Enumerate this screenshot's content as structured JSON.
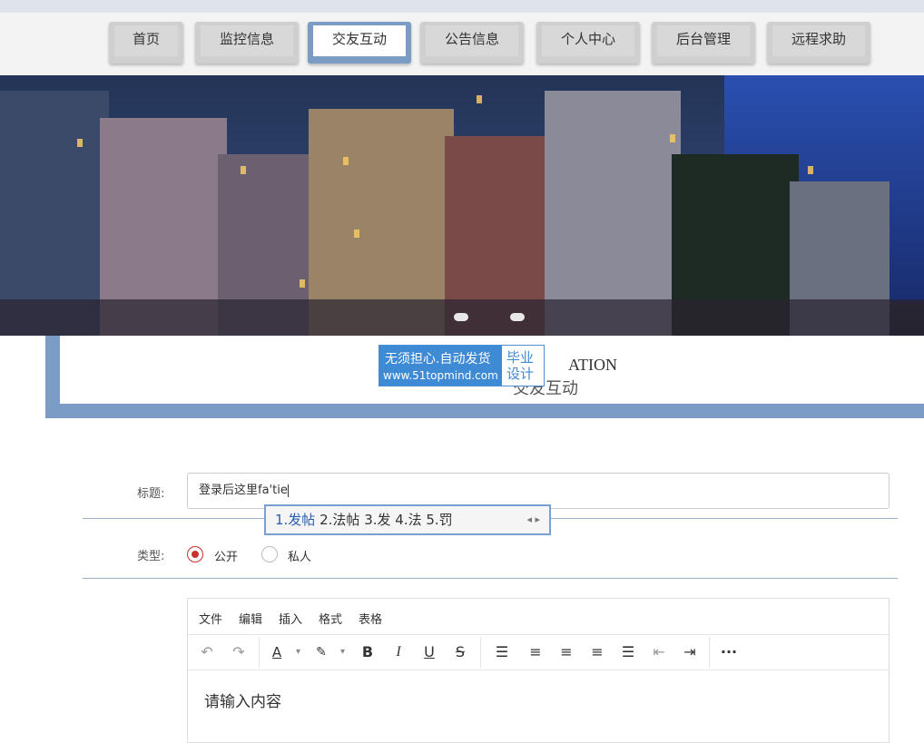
{
  "nav": {
    "items": [
      {
        "label": "首页"
      },
      {
        "label": "监控信息"
      },
      {
        "label": "交友互动"
      },
      {
        "label": "公告信息"
      },
      {
        "label": "个人中心"
      },
      {
        "label": "后台管理"
      },
      {
        "label": "远程求助"
      }
    ],
    "active_index": 2
  },
  "page_header": {
    "title_en": "ATION",
    "title_cn": "交友互动"
  },
  "watermark": {
    "line1": "无须担心.自动发货",
    "line2": "www.51topmind.com",
    "badge_top": "毕业",
    "badge_bottom": "设计"
  },
  "form": {
    "title_label": "标题:",
    "title_value": "登录后这里fa'tie",
    "type_label": "类型:",
    "type_options": [
      "公开",
      "私人"
    ],
    "type_selected": "公开"
  },
  "ime": {
    "candidates": [
      "1.发帖",
      "2.法帖",
      "3.发",
      "4.法",
      "5.罚"
    ]
  },
  "editor": {
    "menu": [
      "文件",
      "编辑",
      "插入",
      "格式",
      "表格"
    ],
    "placeholder": "请输入内容",
    "toolbar_icons": [
      "undo-icon",
      "redo-icon",
      "text-color-icon",
      "highlight-icon",
      "bold-icon",
      "italic-icon",
      "underline-icon",
      "strikethrough-icon",
      "line-height-icon",
      "align-left-icon",
      "align-center-icon",
      "align-right-icon",
      "align-justify-icon",
      "outdent-icon",
      "indent-icon",
      "more-icon"
    ]
  }
}
